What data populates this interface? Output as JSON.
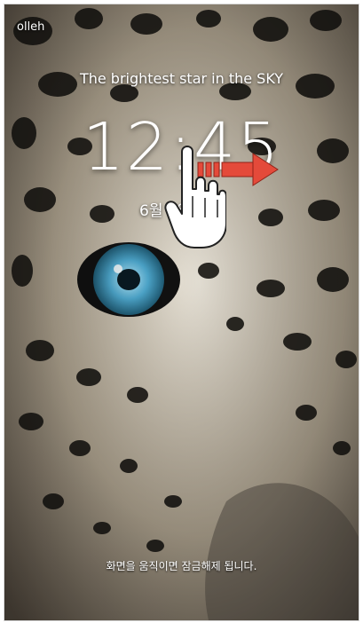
{
  "status_bar": {
    "carrier": "olleh"
  },
  "lockscreen": {
    "owner_message": "The brightest star in the SKY",
    "time": "12:45",
    "date": "6월 3일 요일",
    "unlock_hint": "화면을 움직이면 잠금해제 됩니다."
  },
  "gesture": {
    "icons": [
      "hand-pointer-icon",
      "swipe-right-arrow-icon"
    ]
  },
  "colors": {
    "eye": "#4ea9cf",
    "fur_light": "#d9d4c7",
    "fur_dark": "#8a7c66",
    "spot": "#1c1a16",
    "arrow": "#e44a3a"
  }
}
